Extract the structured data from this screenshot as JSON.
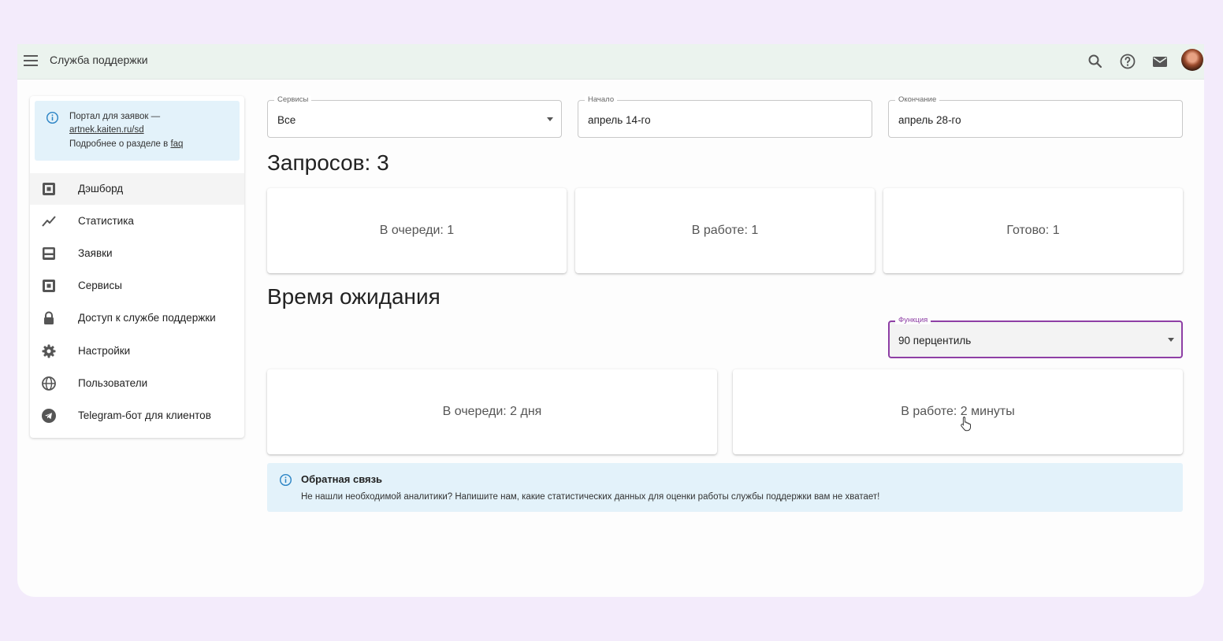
{
  "header": {
    "title": "Служба поддержки",
    "icons": [
      "menu-icon",
      "search-icon",
      "help-icon",
      "mail-icon",
      "avatar"
    ]
  },
  "sidebar": {
    "info": {
      "line1": "Портал для заявок —",
      "link": "artnek.kaiten.ru/sd",
      "line3_prefix": "Подробнее о разделе в ",
      "faq": "faq"
    },
    "items": [
      {
        "label": "Дэшборд",
        "icon": "dashboard-icon",
        "active": true
      },
      {
        "label": "Статистика",
        "icon": "chart-line-icon"
      },
      {
        "label": "Заявки",
        "icon": "inbox-icon"
      },
      {
        "label": "Сервисы",
        "icon": "services-icon"
      },
      {
        "label": "Доступ к службе поддержки",
        "icon": "lock-icon"
      },
      {
        "label": "Настройки",
        "icon": "gear-icon"
      },
      {
        "label": "Пользователи",
        "icon": "globe-icon"
      },
      {
        "label": "Telegram-бот для клиентов",
        "icon": "telegram-icon"
      }
    ]
  },
  "filters": {
    "services": {
      "label": "Сервисы",
      "value": "Все"
    },
    "start": {
      "label": "Начало",
      "value": "апрель 14-го"
    },
    "end": {
      "label": "Окончание",
      "value": "апрель 28-го"
    }
  },
  "requests": {
    "heading": "Запросов: 3",
    "cards": [
      "В очереди: 1",
      "В работе: 1",
      "Готово: 1"
    ]
  },
  "waiting": {
    "heading": "Время ожидания",
    "function": {
      "label": "Функция",
      "value": "90 перцентиль"
    },
    "cards": [
      "В очереди: 2 дня",
      "В работе: 2 минуты"
    ]
  },
  "feedback": {
    "title": "Обратная связь",
    "text": "Не нашли необходимой аналитики? Напишите нам, какие статистических данных для оценки работы службы поддержки вам не хватает!"
  },
  "colors": {
    "background": "#f3ebfb",
    "topbar": "#ebf3ee",
    "info_bg": "#e3f2fa",
    "accent": "#8e3fa5",
    "info_icon": "#2f86c6"
  }
}
